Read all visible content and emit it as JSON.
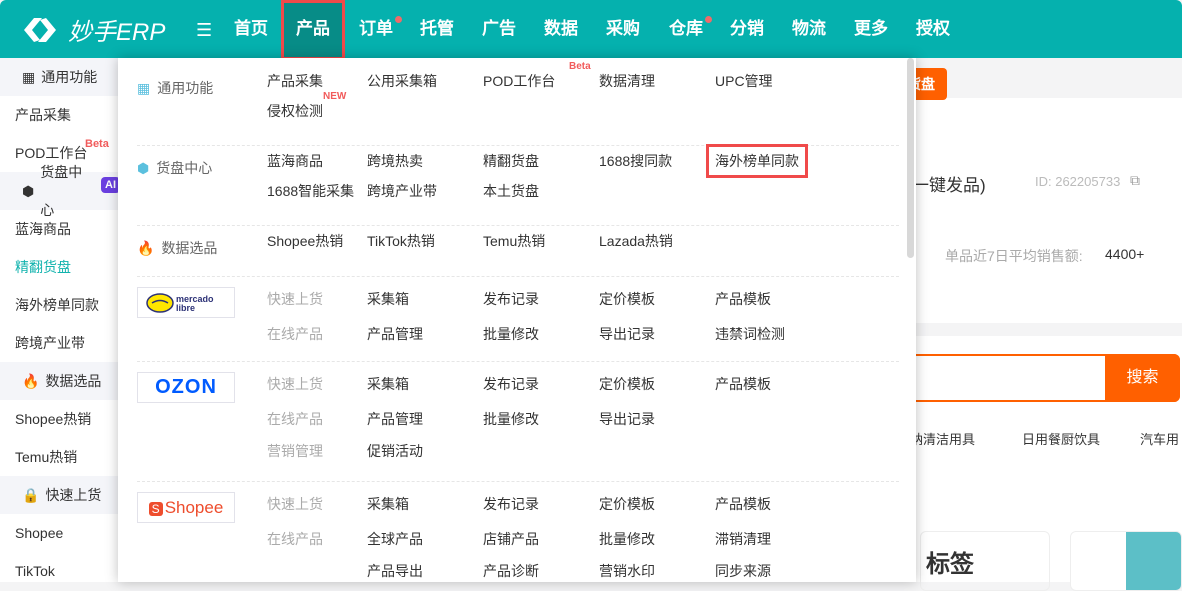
{
  "header": {
    "logo": "妙手ERP",
    "nav": [
      {
        "label": "首页"
      },
      {
        "label": "产品",
        "active": true
      },
      {
        "label": "订单",
        "dot": true
      },
      {
        "label": "托管"
      },
      {
        "label": "广告"
      },
      {
        "label": "数据"
      },
      {
        "label": "采购"
      },
      {
        "label": "仓库",
        "dot": true
      },
      {
        "label": "分销"
      },
      {
        "label": "物流"
      },
      {
        "label": "更多"
      },
      {
        "label": "授权"
      }
    ]
  },
  "sidebar": [
    {
      "group": "通用功能",
      "icon": "grid-icon"
    },
    {
      "label": "产品采集"
    },
    {
      "label": "POD工作台",
      "badge": "Beta"
    },
    {
      "group": "货盘中心",
      "icon": "cube-icon",
      "badge": "AI"
    },
    {
      "label": "蓝海商品"
    },
    {
      "label": "精翻货盘",
      "active": true
    },
    {
      "label": "海外榜单同款"
    },
    {
      "label": "跨境产业带"
    },
    {
      "group": "数据选品",
      "icon": "fire-icon"
    },
    {
      "label": "Shopee热销"
    },
    {
      "label": "Temu热销"
    },
    {
      "group": "快速上货",
      "icon": "bag-icon"
    },
    {
      "label": "Shopee"
    },
    {
      "label": "TikTok"
    }
  ],
  "background": {
    "button": "货盘",
    "title_tail": "捷一键发品)",
    "id": "ID: 262205733",
    "stat_label": "单品近7日平均销售额:",
    "stat_value": "4400+",
    "search": "搜索",
    "cats": [
      "纳清洁用具",
      "日用餐厨饮具",
      "汽车用"
    ],
    "card_text": "标签"
  },
  "dropdown": [
    {
      "label": "通用功能",
      "icon": "grid-icon",
      "rows": [
        [
          {
            "t": "产品采集"
          },
          {
            "t": "公用采集箱"
          },
          {
            "t": "POD工作台",
            "sup": "Beta"
          },
          {
            "t": "数据清理"
          },
          {
            "t": "UPC管理"
          }
        ],
        [
          {
            "t": "侵权检测",
            "sup": "NEW"
          }
        ]
      ]
    },
    {
      "label": "货盘中心",
      "icon": "cube-icon",
      "rows": [
        [
          {
            "t": "蓝海商品"
          },
          {
            "t": "跨境热卖"
          },
          {
            "t": "精翻货盘"
          },
          {
            "t": "1688搜同款"
          },
          {
            "t": "海外榜单同款",
            "hl": true
          }
        ],
        [
          {
            "t": "1688智能采集"
          },
          {
            "t": "跨境产业带"
          },
          {
            "t": "本土货盘"
          }
        ]
      ]
    },
    {
      "label": "数据选品",
      "icon": "fire-icon",
      "rows": [
        [
          {
            "t": "Shopee热销"
          },
          {
            "t": "TikTok热销"
          },
          {
            "t": "Temu热销"
          },
          {
            "t": "Lazada热销"
          }
        ]
      ]
    },
    {
      "logo": "mercado libre",
      "rows": [
        [
          {
            "t": "快速上货",
            "g": true
          },
          {
            "t": "采集箱"
          },
          {
            "t": "发布记录"
          },
          {
            "t": "定价模板"
          },
          {
            "t": "产品模板"
          }
        ],
        [
          {
            "t": "在线产品",
            "g": true
          },
          {
            "t": "产品管理"
          },
          {
            "t": "批量修改"
          },
          {
            "t": "导出记录"
          },
          {
            "t": "违禁词检测"
          }
        ]
      ]
    },
    {
      "logo": "OZON",
      "rows": [
        [
          {
            "t": "快速上货",
            "g": true
          },
          {
            "t": "采集箱"
          },
          {
            "t": "发布记录"
          },
          {
            "t": "定价模板"
          },
          {
            "t": "产品模板"
          }
        ],
        [
          {
            "t": "在线产品",
            "g": true
          },
          {
            "t": "产品管理"
          },
          {
            "t": "批量修改"
          },
          {
            "t": "导出记录"
          }
        ],
        [
          {
            "t": "营销管理",
            "g": true
          },
          {
            "t": "促销活动"
          }
        ]
      ]
    },
    {
      "logo": "Shopee",
      "rows": [
        [
          {
            "t": "快速上货",
            "g": true
          },
          {
            "t": "采集箱"
          },
          {
            "t": "发布记录"
          },
          {
            "t": "定价模板"
          },
          {
            "t": "产品模板"
          }
        ],
        [
          {
            "t": "在线产品",
            "g": true
          },
          {
            "t": "全球产品"
          },
          {
            "t": "店铺产品"
          },
          {
            "t": "批量修改"
          },
          {
            "t": "滞销清理"
          }
        ],
        [
          {
            "t": "",
            "g": true
          },
          {
            "t": "产品导出"
          },
          {
            "t": "产品诊断"
          },
          {
            "t": "营销水印"
          },
          {
            "t": "同步来源"
          }
        ]
      ]
    }
  ]
}
